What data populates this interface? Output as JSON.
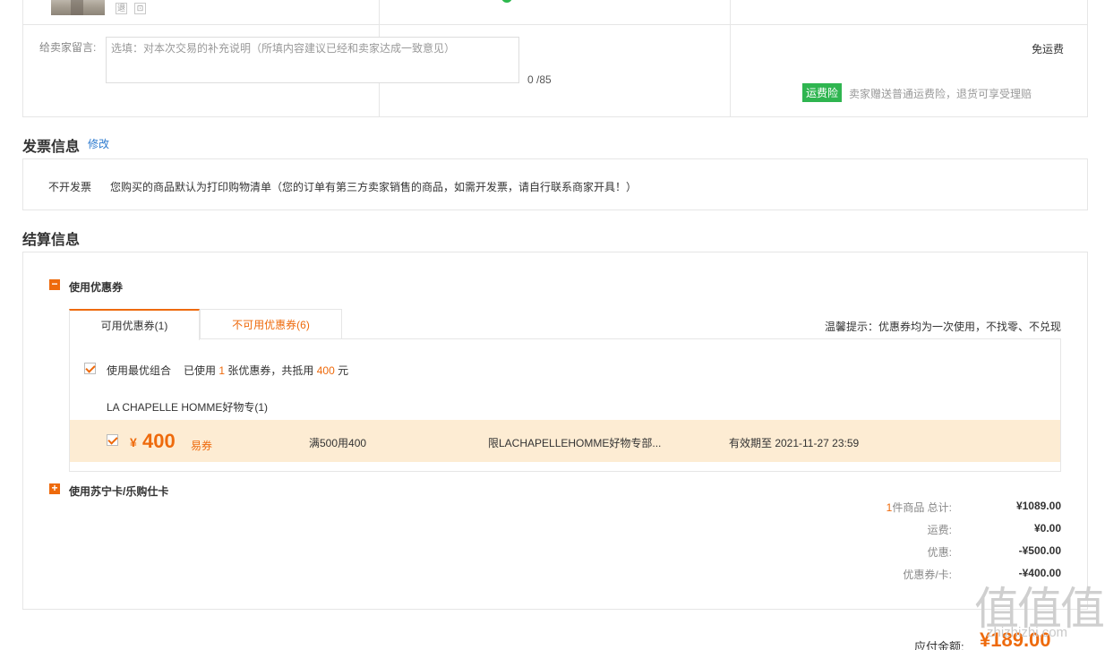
{
  "order": {
    "icon_retreat": "退",
    "icon_other": "",
    "message_label": "给卖家留言:",
    "message_placeholder": "选填：对本次交易的补充说明（所填内容建议已经和卖家达成一致意见）",
    "message_count": "0 /85",
    "free_shipping": "免运费",
    "insurance_badge": "运费险",
    "insurance_text": "卖家赠送普通运费险，退货可享受理赔"
  },
  "invoice": {
    "title": "发票信息",
    "edit": "修改",
    "type": "不开发票",
    "desc": "您购买的商品默认为打印购物清单（您的订单有第三方卖家销售的商品，如需开发票，请自行联系商家开具！）"
  },
  "settlement": {
    "title": "结算信息",
    "coupon_toggle": "使用优惠券",
    "tabs": [
      "可用优惠券(1)",
      "不可用优惠券(6)"
    ],
    "tip": "温馨提示：优惠券均为一次使用，不找零、不兑现",
    "best_combo": "使用最优组合",
    "used_prefix": "已使用",
    "used_count": "1",
    "used_middle": "张优惠券，共抵用",
    "used_amount": "400",
    "used_suffix": "元",
    "shop_name": "LA CHAPELLE HOMME好物专(1)",
    "coupon": {
      "yen": "¥",
      "amount": "400",
      "type": "易券",
      "condition": "满500用400",
      "scope": "限LACHAPELLEHOMME好物专部...",
      "validity": "有效期至 2021-11-27 23:59"
    },
    "card_toggle": "使用苏宁卡/乐购仕卡",
    "summary": {
      "count": "1",
      "count_label": "件商品 总计:",
      "total": "¥1089.00",
      "shipping_label": "运费:",
      "shipping": "¥0.00",
      "discount_label": "优惠:",
      "discount": "-¥500.00",
      "coupon_label": "优惠券/卡:",
      "coupon_value": "-¥400.00"
    },
    "pay_label": "应付金额:",
    "pay_value": "¥189.00"
  },
  "watermark": {
    "big": "值值值",
    "small": "zhizhizhi.com"
  },
  "colors": {
    "accent": "#ee6a0c",
    "green": "#2fb550",
    "link": "#2e7bcf",
    "coupon_bg": "#fdecd3"
  }
}
